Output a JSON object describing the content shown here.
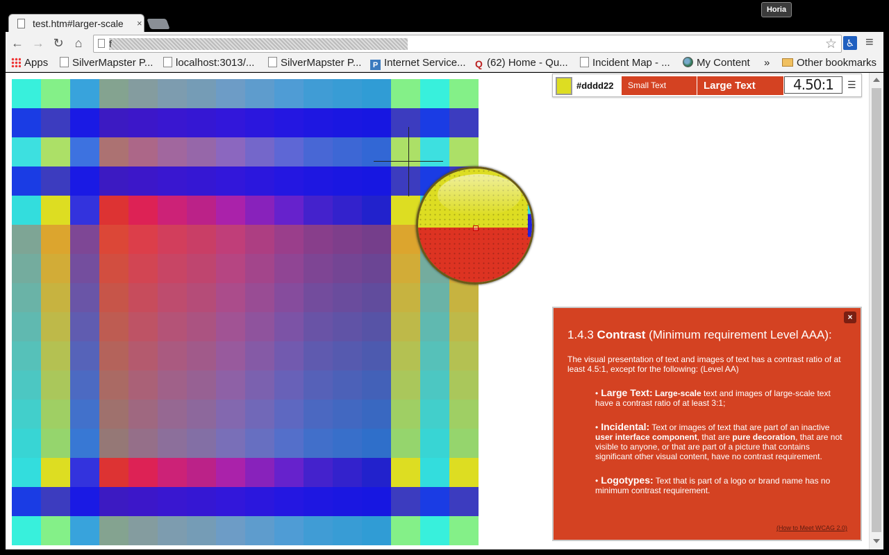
{
  "browser": {
    "tab_title": "test.htm#larger-scale",
    "tab_close": "×",
    "user_badge": "Horia",
    "url": "f",
    "nav": {
      "back": "←",
      "forward": "→",
      "reload": "↻",
      "home": "⌂"
    },
    "star": "☆",
    "menu": "≡",
    "ext_glyph": "♿"
  },
  "bookmarks": [
    {
      "label": "Apps",
      "icon": "apps-icon"
    },
    {
      "label": "SilverMapster P...",
      "icon": "page-icon"
    },
    {
      "label": "localhost:3013/...",
      "icon": "page-icon"
    },
    {
      "label": "SilverMapster P...",
      "icon": "page-icon"
    },
    {
      "label": "Internet Service...",
      "icon": "p-icon"
    },
    {
      "label": "(62) Home - Qu...",
      "icon": "quora-icon"
    },
    {
      "label": "Incident Map - ...",
      "icon": "page-icon"
    },
    {
      "label": "My Content",
      "icon": "globe-icon"
    }
  ],
  "bookmarks_more": "»",
  "other_bookmarks": "Other bookmarks",
  "panel": {
    "color_hex": "#dddd22",
    "swatch_color": "#dddd22",
    "small_text_label": "Small Text",
    "large_text_label": "Large Text",
    "ratio": "4.50:1",
    "list_glyph": "☰"
  },
  "magnifier": {
    "top_color": "#dddd22",
    "bottom_color": "#dd3322"
  },
  "info": {
    "close_glyph": "×",
    "heading_number": "1.4.3 ",
    "heading_term": "Contrast",
    "heading_rest": " (Minimum requirement Level AAA):",
    "intro": "The visual presentation of text and images of text has a contrast ratio of at least 4.5:1, except for the following: (Level AA)",
    "items": [
      {
        "term": "Large Text:",
        "text_bold": "Large-scale",
        "text": " text and images of large-scale text have a contrast ratio of at least 3:1;"
      },
      {
        "term": "Incidental:",
        "text_a": " Text or images of text that are part of an inactive ",
        "bold_a": "user interface component",
        "text_b": ", that are ",
        "bold_b": "pure decoration",
        "text_c": ", that are not visible to anyone, or that are part of a picture that contains significant other visual content, have no contrast requirement."
      },
      {
        "term": "Logotypes:",
        "text": " Text that is part of a logo or brand name has no minimum contrast requirement."
      }
    ],
    "link": "(How to Meet WCAG 2.0)"
  },
  "grid_colors": {
    "columns": [
      "#33dddd",
      "#dddd22",
      "#3333dd",
      "#dd3333",
      "#dd2255",
      "#cc2277",
      "#bb2288",
      "#aa22aa",
      "#8822bb",
      "#6622cc",
      "#4422cc",
      "#3322cc",
      "#2222cc",
      "#dddd22",
      "#33dddd",
      "#dddd22"
    ]
  }
}
